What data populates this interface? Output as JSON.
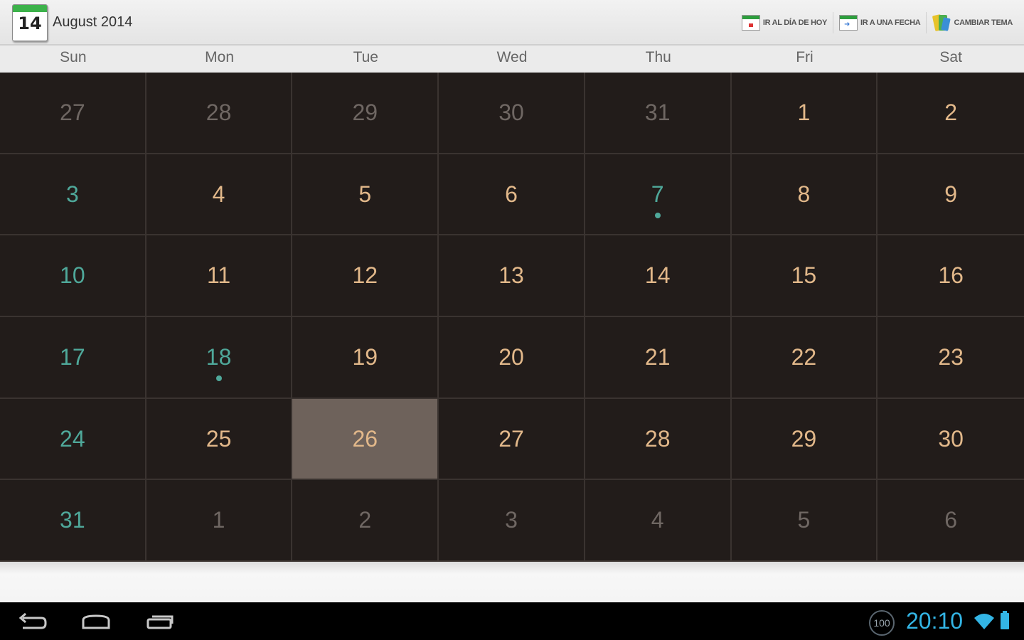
{
  "app": {
    "icon_day": "14",
    "title": "August 2014"
  },
  "actions": [
    {
      "label": "IR AL DÍA DE HOY",
      "icon": "calendar-today-icon"
    },
    {
      "label": "IR A UNA FECHA",
      "icon": "calendar-goto-icon"
    },
    {
      "label": "CAMBIAR TEMA",
      "icon": "palette-icon"
    }
  ],
  "weekdays": [
    "Sun",
    "Mon",
    "Tue",
    "Wed",
    "Thu",
    "Fri",
    "Sat"
  ],
  "weeks": [
    [
      {
        "day": "27",
        "dim": true
      },
      {
        "day": "28",
        "dim": true
      },
      {
        "day": "29",
        "dim": true
      },
      {
        "day": "30",
        "dim": true
      },
      {
        "day": "31",
        "dim": true
      },
      {
        "day": "1"
      },
      {
        "day": "2"
      }
    ],
    [
      {
        "day": "3",
        "sunday": true
      },
      {
        "day": "4"
      },
      {
        "day": "5"
      },
      {
        "day": "6"
      },
      {
        "day": "7",
        "event": true,
        "teal": true
      },
      {
        "day": "8"
      },
      {
        "day": "9"
      }
    ],
    [
      {
        "day": "10",
        "sunday": true
      },
      {
        "day": "11"
      },
      {
        "day": "12"
      },
      {
        "day": "13"
      },
      {
        "day": "14"
      },
      {
        "day": "15"
      },
      {
        "day": "16"
      }
    ],
    [
      {
        "day": "17",
        "sunday": true
      },
      {
        "day": "18",
        "event": true,
        "teal": true
      },
      {
        "day": "19"
      },
      {
        "day": "20"
      },
      {
        "day": "21"
      },
      {
        "day": "22"
      },
      {
        "day": "23"
      }
    ],
    [
      {
        "day": "24",
        "sunday": true
      },
      {
        "day": "25"
      },
      {
        "day": "26",
        "selected": true
      },
      {
        "day": "27"
      },
      {
        "day": "28"
      },
      {
        "day": "29"
      },
      {
        "day": "30"
      }
    ],
    [
      {
        "day": "31",
        "sunday": true
      },
      {
        "day": "1",
        "dim": true
      },
      {
        "day": "2",
        "dim": true
      },
      {
        "day": "3",
        "dim": true
      },
      {
        "day": "4",
        "dim": true
      },
      {
        "day": "5",
        "dim": true
      },
      {
        "day": "6",
        "dim": true
      }
    ]
  ],
  "status": {
    "battery_percent": "100",
    "time": "20:10"
  },
  "colors": {
    "accent_teal": "#4fa89a",
    "day_text": "#e2b88a",
    "selected_bg": "#6e625b",
    "clock_blue": "#33b5e5"
  }
}
